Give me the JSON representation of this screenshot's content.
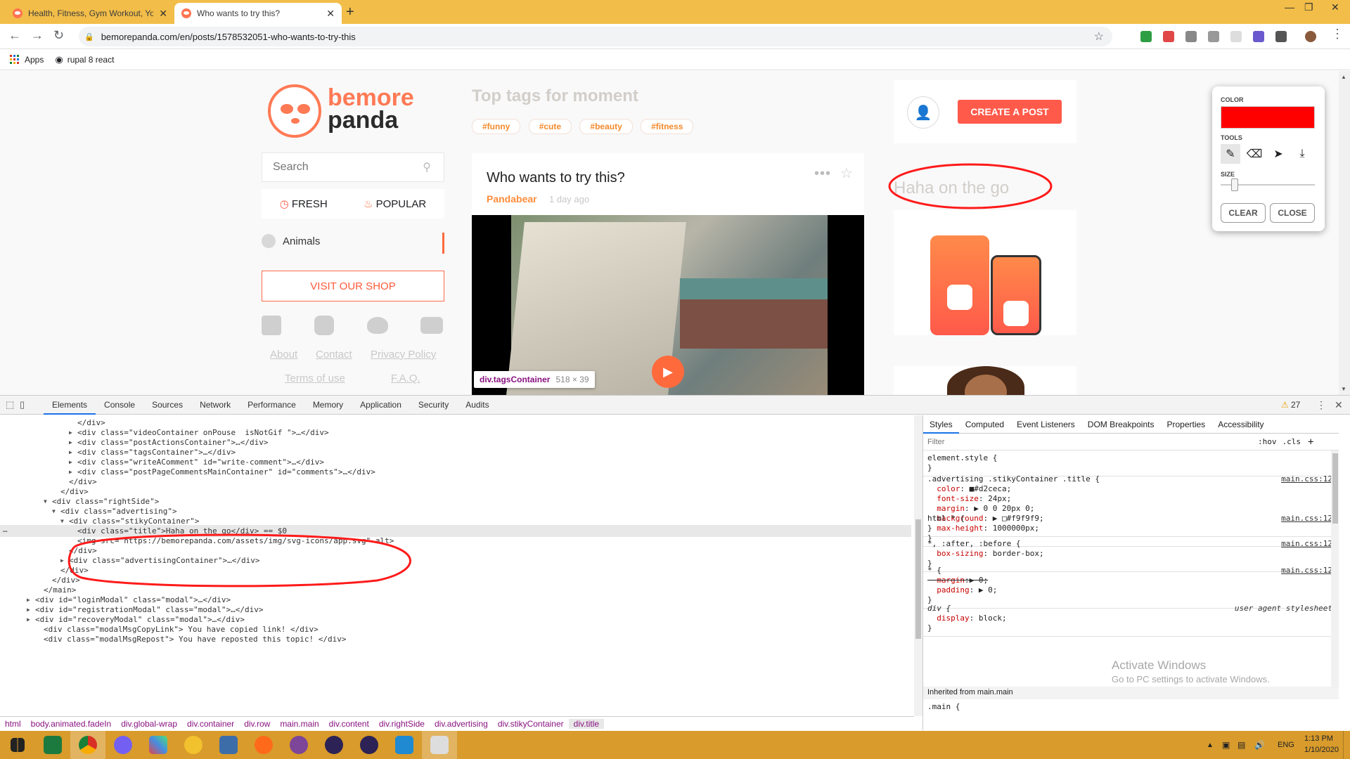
{
  "browser": {
    "tabs": [
      {
        "title": "Health, Fitness, Gym Workout, Yo",
        "active": false
      },
      {
        "title": "Who wants to try this?",
        "active": true
      }
    ],
    "url": "bemorepanda.com/en/posts/1578532051-who-wants-to-try-this",
    "bookmarks": [
      {
        "label": "Apps"
      },
      {
        "label": "rupal 8 react"
      }
    ]
  },
  "site": {
    "logo_top": "bemore",
    "logo_bottom": "panda",
    "search_placeholder": "Search",
    "fresh_label": "FRESH",
    "popular_label": "POPULAR",
    "category": "Animals",
    "shop_button": "VISIT OUR SHOP",
    "footer_links": [
      "About",
      "Contact",
      "Privacy Policy",
      "Terms of use",
      "F.A.Q."
    ],
    "top_tags_title": "Top tags for moment",
    "tags": [
      "#funny",
      "#cute",
      "#beauty",
      "#fitness"
    ],
    "post": {
      "title": "Who wants to try this?",
      "author": "Pandabear",
      "time": "1 day ago"
    },
    "tooltip": {
      "name": "div.tagsContainer",
      "size": "518 × 39"
    },
    "create_post": "CREATE A POST",
    "ad_title": "Haha on the go"
  },
  "drawing_tool": {
    "color_label": "COLOR",
    "tools_label": "TOOLS",
    "size_label": "SIZE",
    "clear_label": "CLEAR",
    "close_label": "CLOSE",
    "color": "#ff0000",
    "size_level": 0.12
  },
  "devtools": {
    "tabs": [
      "Elements",
      "Console",
      "Sources",
      "Network",
      "Performance",
      "Memory",
      "Application",
      "Security",
      "Audits"
    ],
    "warnings": "27",
    "dom_lines": [
      "</div>",
      "<div class=\"videoContainer onPouse  isNotGif \">…</div>",
      "<div class=\"postActionsContainer\">…</div>",
      "<div class=\"tagsContainer\">…</div>",
      "<div class=\"writeAComment\" id=\"write-comment\">…</div>",
      "<div class=\"postPageCommentsMainContainer\" id=\"comments\">…</div>",
      "</div>",
      "</div>",
      "<div class=\"rightSide\">",
      "<div class=\"advertising\">",
      "<div class=\"stikyContainer\">",
      "<div class=\"title\">Haha on the go</div> == $0",
      "<img src=\"https://bemorepanda.com/assets/img/svg-icons/app.svg\" alt>",
      "</div>",
      "<div class=\"advertisingContainer\">…</div>",
      "</div>",
      "</div>",
      "</main>",
      "<div id=\"loginModal\" class=\"modal\">…</div>",
      "<div id=\"registrationModal\" class=\"modal\">…</div>",
      "<div id=\"recoveryModal\" class=\"modal\">…</div>",
      "<div class=\"modalMsgCopyLink\"> You have copied link! </div>",
      "<div class=\"modalMsgRepost\"> You have reposted this topic! </div>"
    ],
    "breadcrumbs": [
      "html",
      "body.animated.fadeIn",
      "div.global-wrap",
      "div.container",
      "div.row",
      "main.main",
      "div.content",
      "div.rightSide",
      "div.advertising",
      "div.stikyContainer",
      "div.title"
    ],
    "styles_tabs": [
      "Styles",
      "Computed",
      "Event Listeners",
      "DOM Breakpoints",
      "Properties",
      "Accessibility"
    ],
    "filter_placeholder": "Filter",
    "hov": ":hov",
    "cls": ".cls",
    "rules": [
      {
        "selector": "element.style {",
        "lines": [
          "}"
        ],
        "source": ""
      },
      {
        "selector": ".advertising .stikyContainer .title {",
        "lines": [
          "  color: ■#d2ceca;",
          "  font-size: 24px;",
          "  margin: ▶ 0 0 20px 0;",
          "  background: ▶ □#f9f9f9;",
          "}"
        ],
        "source": "main.css:12"
      },
      {
        "selector": "html * {",
        "lines": [
          "  max-height: 1000000px;",
          "}"
        ],
        "source": "main.css:12"
      },
      {
        "selector": "*, :after, :before {",
        "lines": [
          "  box-sizing: border-box;",
          "}"
        ],
        "source": "main.css:12"
      },
      {
        "selector": "* {",
        "lines": [
          "  margin:▶ 0;",
          "  padding: ▶ 0;",
          "}"
        ],
        "source": "main.css:12"
      },
      {
        "selector": "div {",
        "lines": [
          "  display: block;",
          "}"
        ],
        "source": "user agent stylesheet"
      }
    ],
    "inherited": "Inherited from main.main",
    "last_selector": ".main {",
    "activate_title": "Activate Windows",
    "activate_sub": "Go to PC settings to activate Windows."
  },
  "taskbar": {
    "lang": "ENG",
    "time": "1:13 PM",
    "date": "1/10/2020"
  }
}
